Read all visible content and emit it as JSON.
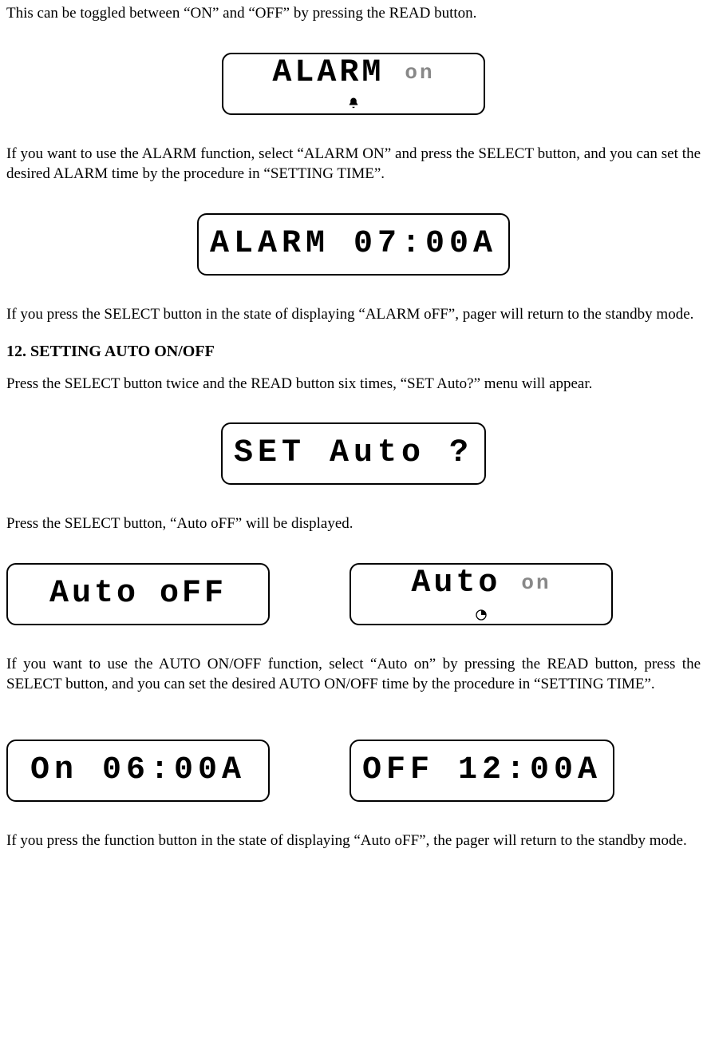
{
  "para1": "This can be toggled between “ON” and “OFF” by pressing the READ button.",
  "lcd1_main": "ALARM",
  "lcd1_sub": "on",
  "para2": "If you want to use the ALARM function, select “ALARM ON” and press the SELECT button, and you can set the desired ALARM time by the procedure in “SETTING TIME”.",
  "lcd2_text": "ALARM 07:00A",
  "para3": "If you press the SELECT button in the state of displaying “ALARM oFF”, pager will return to the standby mode.",
  "heading": "12. SETTING AUTO ON/OFF",
  "para4": "Press the SELECT button twice and the READ button six times, “SET Auto?” menu will appear.",
  "lcd3_text": "SET Auto ?",
  "para5": "Press the SELECT button, “Auto oFF” will be displayed.",
  "lcd4_main": "Auto",
  "lcd4_sub": "oFF",
  "lcd5_main": "Auto",
  "lcd5_sub": "on",
  "para6": "If you want to use the AUTO ON/OFF function, select “Auto on” by pressing the READ button, press the SELECT button, and you can set the desired AUTO ON/OFF time by the procedure in “SETTING TIME”.",
  "lcd6_text": "On  06:00A",
  "lcd7_text": "OFF  12:00A",
  "para7": "If you press the function button in the state of displaying “Auto oFF”, the pager will return to the standby mode."
}
